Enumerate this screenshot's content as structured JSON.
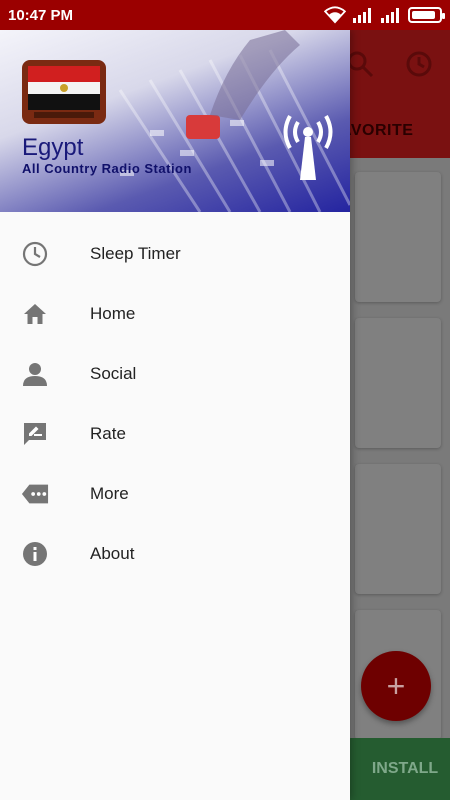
{
  "status_bar": {
    "time": "10:47 PM"
  },
  "background_app": {
    "tab_label": "AVORITE",
    "install_label": "INSTALL",
    "fab_label": "+"
  },
  "drawer": {
    "header": {
      "title": "Egypt",
      "subtitle": "All Country Radio Station"
    },
    "items": [
      {
        "label": "Sleep Timer",
        "icon": "clock-icon"
      },
      {
        "label": "Home",
        "icon": "home-icon"
      },
      {
        "label": "Social",
        "icon": "person-icon"
      },
      {
        "label": "Rate",
        "icon": "rate-icon"
      },
      {
        "label": "More",
        "icon": "more-icon"
      },
      {
        "label": "About",
        "icon": "info-icon"
      }
    ]
  },
  "colors": {
    "status_bar": "#9b0000",
    "icon_grey": "#757575",
    "fab": "#6e0000",
    "install": "#255c30"
  }
}
